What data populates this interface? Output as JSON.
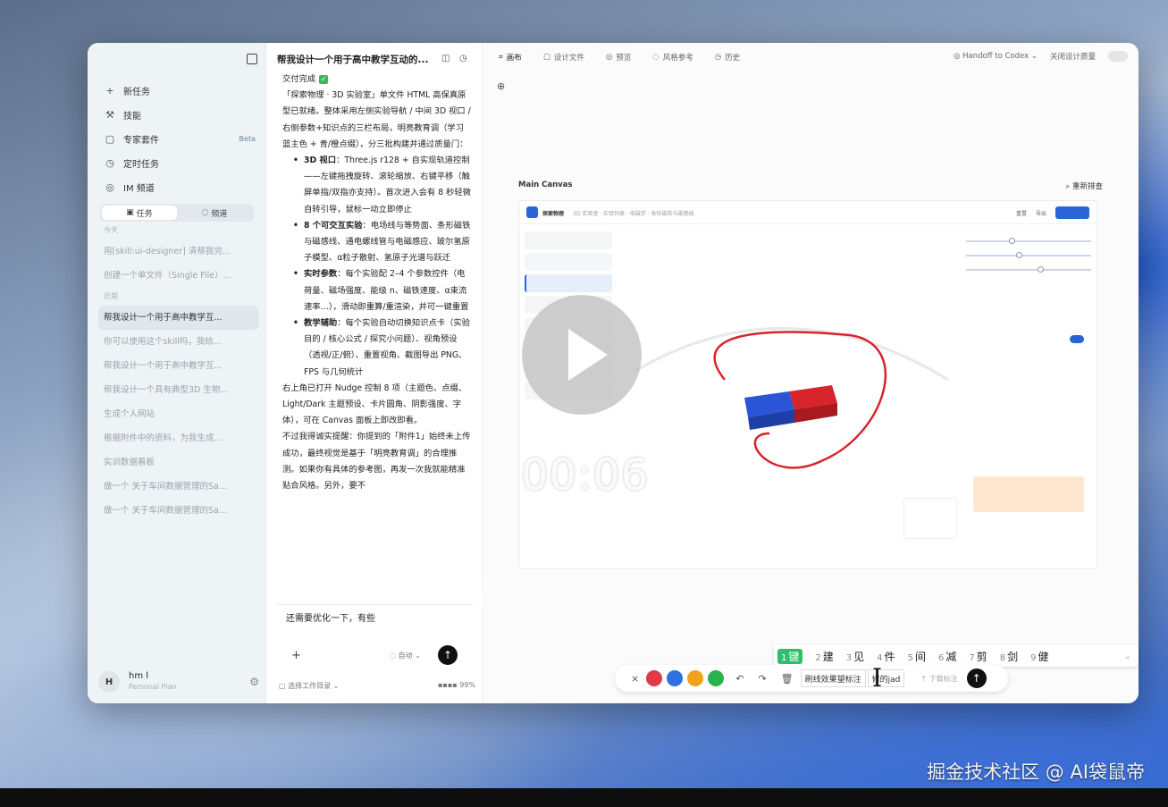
{
  "sidebar": {
    "nav": [
      {
        "icon": "plus-icon",
        "label": "新任务"
      },
      {
        "icon": "skill-icon",
        "label": "技能"
      },
      {
        "icon": "folder-icon",
        "label": "专家套件",
        "badge": "Beta"
      },
      {
        "icon": "clock-icon",
        "label": "定时任务"
      },
      {
        "icon": "im-icon",
        "label": "IM 频道"
      }
    ],
    "tabs": [
      "任务",
      "频道"
    ],
    "groups": [
      {
        "title": "今天",
        "items": [
          "用[skill:ui-designer] 清帮我完...",
          "创建一个单文件（Single File）..."
        ]
      },
      {
        "title": "近期",
        "items": [
          "帮我设计一个用于高中教学互...",
          "你可以使用这个skill吗，我给...",
          "帮我设计一个用于高中教学互...",
          "帮我设计一个具有典型3D 生物...",
          "生成个人网站",
          "根据附件中的资料，为我生成...",
          "实训数据看板",
          "做一个 关于车间数据管理的Sa...",
          "做一个 关于车间数据管理的Sa..."
        ]
      }
    ],
    "active_item": "帮我设计一个用于高中教学互...",
    "user": {
      "initial": "H",
      "name": "hm l",
      "plan": "Personal Plan"
    }
  },
  "chat": {
    "title": "帮我设计一个用于高中教学互动的...",
    "status": "交付完成",
    "intro": "「探索物理 · 3D 实验室」单文件 HTML 高保真原型已就绪。整体采用左侧实验导航 / 中间 3D 视口 / 右侧参数+知识点的三栏布局，明亮教育调（学习蓝主色 + 青/橙点缀），分三批构建并通过质量门：",
    "bullets": [
      {
        "head": "3D 视口",
        "text": "：Three.js r128 + 自实现轨道控制——左键拖拽旋转、滚轮缩放、右键平移（触屏单指/双指亦支持）。首次进入会有 8 秒轻微自转引导，鼠标一动立即停止"
      },
      {
        "head": "8 个可交互实验",
        "text": "：电场线与等势面、条形磁铁与磁感线、通电螺线管与电磁感应、玻尔氢原子模型、α粒子散射、氢原子光谱与跃迁"
      },
      {
        "head": "实时参数",
        "text": "：每个实验配 2–4 个参数控件（电荷量、磁场强度、能级 n、磁铁速度、α束流速率…），滑动即重算/重渲染，并可一键重置"
      },
      {
        "head": "教学辅助",
        "text": "：每个实验自动切换知识点卡（实验目的 / 核心公式 / 探究小问题）、视角预设（透视/正/俯）、重置视角、截图导出 PNG、FPS 与几何统计"
      }
    ],
    "after": "右上角已打开 Nudge 控制 8 项（主题色、点缀、Light/Dark 主题预设、卡片圆角、阴影强度、字体），可在 Canvas 面板上即改即看。",
    "note": "不过我得诚实提醒：你提到的「附件1」始终未上传成功，最终视觉是基于「明亮教育调」的合理推测。如果你有具体的参考图，再发一次我就能精准贴合风格。另外，要不",
    "input_text": "还需要优化一下，有些",
    "mode_label": "自动",
    "footer_left": "选择工作目录",
    "footer_right": "99%"
  },
  "canvas": {
    "tabs": [
      "画布",
      "设计文件",
      "预览",
      "风格参考",
      "历史"
    ],
    "active_tab": "画布",
    "handoff": "Handoff to Codex",
    "toggle_label": "关闭设计质量",
    "main_label": "Main Canvas",
    "refresh_label": "重新排查",
    "preview": {
      "brand": "探索物理",
      "crumbs": "3D 实验室 · 实验列表 · 电磁学 · 条形磁铁与磁感线",
      "actions": [
        "重置",
        "导出"
      ]
    }
  },
  "overlay": {
    "timer": "00:06"
  },
  "ime": {
    "candidates": [
      {
        "n": "1",
        "t": "键"
      },
      {
        "n": "2",
        "t": "建"
      },
      {
        "n": "3",
        "t": "见"
      },
      {
        "n": "4",
        "t": "件"
      },
      {
        "n": "5",
        "t": "间"
      },
      {
        "n": "6",
        "t": "减"
      },
      {
        "n": "7",
        "t": "剪"
      },
      {
        "n": "8",
        "t": "剑"
      },
      {
        "n": "9",
        "t": "健"
      }
    ],
    "selected": 0
  },
  "annotate": {
    "colors": [
      "#e03a45",
      "#2f6fe0",
      "#f0a21a",
      "#2bb24c"
    ],
    "field1": "刷线效果望标注",
    "field2": "修的jad",
    "hint": "↑ 下载标注"
  },
  "watermark": "掘金技术社区 @ AI袋鼠帝"
}
